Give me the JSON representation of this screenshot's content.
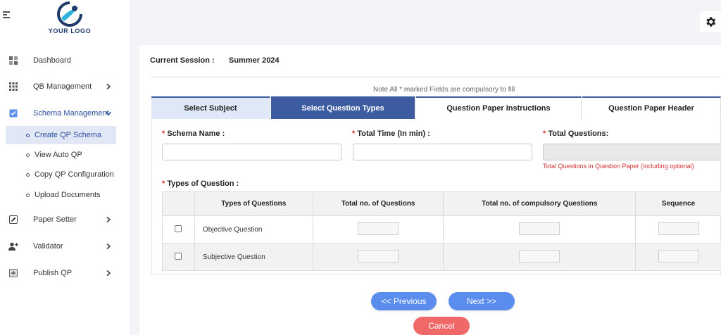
{
  "logo": {
    "text": "YOUR LOGO"
  },
  "sidebar": {
    "items": [
      {
        "label": "Dashboard",
        "icon": "dashboard-icon"
      },
      {
        "label": "QB Management",
        "icon": "grid-icon"
      },
      {
        "label": "Schema Management",
        "icon": "checkbox-icon"
      },
      {
        "label": "Paper Setter",
        "icon": "edit-icon"
      },
      {
        "label": "Validator",
        "icon": "add-user-icon"
      },
      {
        "label": "Publish QP",
        "icon": "publish-icon"
      }
    ],
    "sub_items": [
      {
        "label": "Create QP Schema"
      },
      {
        "label": "View Auto QP"
      },
      {
        "label": "Copy QP Configuration"
      },
      {
        "label": "Upload Documents"
      }
    ]
  },
  "session": {
    "label": "Current Session :",
    "value": "Summer 2024"
  },
  "note": "Note   All * marked Fields are compulsory to fill",
  "tabs": [
    {
      "label": "Select Subject"
    },
    {
      "label": "Select Question Types"
    },
    {
      "label": "Question Paper Instructions"
    },
    {
      "label": "Question Paper Header"
    }
  ],
  "form": {
    "schema_name_label": "Schema Name :",
    "total_time_label": "Total Time (In min) :",
    "total_questions_label": "Total Questions:",
    "total_questions_hint": "Total Questions in Question Paper (including optional)",
    "types_label": "Types of Question :",
    "schema_name_value": "",
    "total_time_value": "",
    "total_questions_value": ""
  },
  "table": {
    "headers": [
      "",
      "Types of Questions",
      "Total no. of Questions",
      "Total no. of compulsory Questions",
      "Sequence"
    ],
    "rows": [
      {
        "name": "Objective Question"
      },
      {
        "name": "Subjective Question"
      }
    ]
  },
  "buttons": {
    "previous": "<< Previous",
    "next": "Next >>",
    "cancel": "Cancel"
  },
  "colors": {
    "primary": "#3d5ba0",
    "button_blue": "#5b8def",
    "button_red": "#f06868",
    "required": "#d32f2f"
  }
}
